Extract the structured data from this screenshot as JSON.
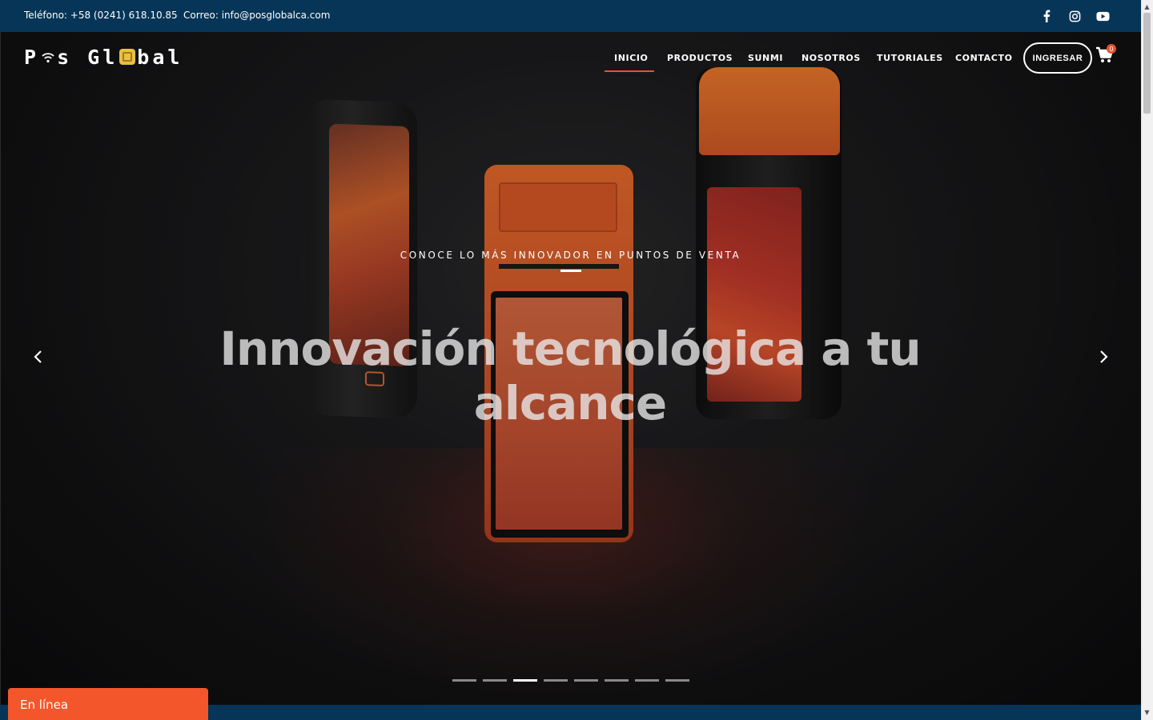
{
  "topbar": {
    "phone": "Teléfono: +58 (0241) 618.10.85",
    "email": "Correo: info@posglobalca.com",
    "social_icons": [
      "facebook-icon",
      "instagram-icon",
      "youtube-icon"
    ]
  },
  "logo": {
    "part1": "P",
    "part2": "s Gl",
    "part3": "bal"
  },
  "nav": {
    "items": [
      {
        "label": "INICIO",
        "active": true
      },
      {
        "label": "PRODUCTOS"
      },
      {
        "label": "SUNMI"
      },
      {
        "label": "NOSOTROS"
      },
      {
        "label": "TUTORIALES"
      },
      {
        "label": "CONTACTO"
      }
    ],
    "login_label": "INGRESAR",
    "cart_count": "0"
  },
  "hero": {
    "eyebrow": "CONOCE LO MÁS INNOVADOR EN PUNTOS DE VENTA",
    "headline_line1": "Innovación tecnológica a tu",
    "headline_line2": "alcance",
    "slides_total": 8,
    "active_slide": 3
  },
  "chat": {
    "label": "En línea"
  },
  "colors": {
    "topbar": "#063557",
    "accent": "#e8522c",
    "chat": "#f4562b"
  }
}
